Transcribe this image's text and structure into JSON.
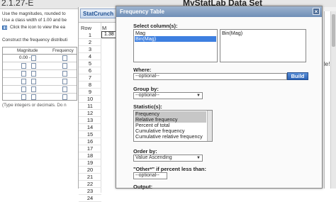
{
  "exercise": {
    "id": "2.1.27-E",
    "line1": "Use the magnitudes, rounded to",
    "line2": "Use a class width of 1.00 and be",
    "line3": "Click the icon to view the ea",
    "line4": "Construct the frequency distributi",
    "table_headers": [
      "Magnitude",
      "Frequency"
    ],
    "first_value": "0.00 -",
    "note": "(Type integers or decimals. Do n",
    "right_fragment": "le!"
  },
  "statcrunch": {
    "window_title": "MyStatLab Data Set",
    "tab_label": "StatCrunch",
    "row_header": "Row",
    "col_header": "M",
    "rows": [
      "1",
      "2",
      "3",
      "4",
      "5",
      "6",
      "7",
      "8",
      "9",
      "10",
      "11",
      "12",
      "13",
      "14",
      "15",
      "16",
      "17",
      "18",
      "19",
      "20",
      "21",
      "22",
      "23",
      "24"
    ],
    "cell_value": "1.38"
  },
  "dialog": {
    "title": "Frequency Table",
    "close_label": "×",
    "select_columns_label": "Select column(s):",
    "columns": [
      "Mag",
      "Bin(Mag)"
    ],
    "selected_columns": [
      "Bin(Mag)"
    ],
    "where_label": "Where:",
    "where_placeholder": "--optional--",
    "build_label": "Build",
    "group_by_label": "Group by:",
    "group_by_value": "--optional--",
    "statistics_label": "Statistic(s):",
    "statistics": [
      "Frequency",
      "Relative frequency",
      "Percent of total",
      "Cumulative frequency",
      "Cumulative relative frequency"
    ],
    "order_by_label": "Order by:",
    "order_by_value": "Value Ascending",
    "other_label": "\"Other*\" if percent less than:",
    "other_value": "--optional--",
    "output_label": "Output:"
  },
  "colors": {
    "dialog_title_bar": "#7f9cc2",
    "selection": "#3d7fe0",
    "build_button": "#2d64b6",
    "badge": "#f7a21c"
  }
}
